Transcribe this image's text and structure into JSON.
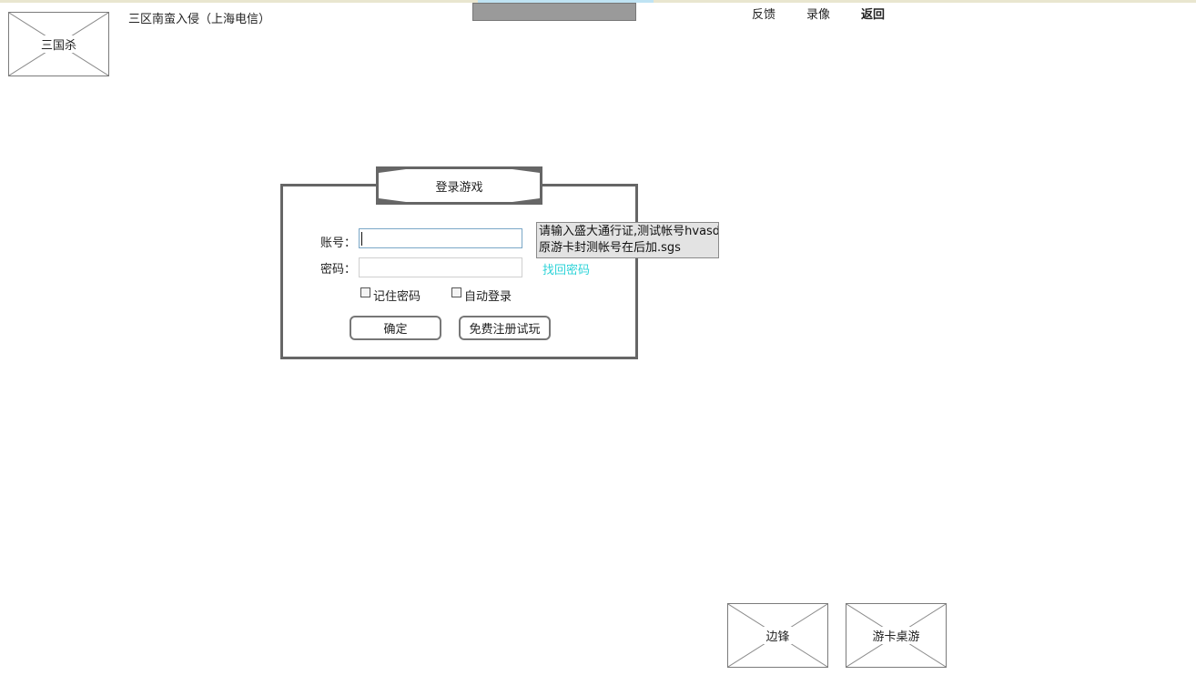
{
  "top": {
    "logo_label": "三国杀",
    "server_title": "三区南蛮入侵（上海电信）",
    "nav": {
      "feedback": "反馈",
      "recording": "录像",
      "back": "返回"
    }
  },
  "login": {
    "tab_title": "登录游戏",
    "account_label": "账号：",
    "password_label": "密码：",
    "account_value": "",
    "password_value": "",
    "forgot_password_link": "找回密码",
    "remember_password": {
      "label": "记住密码",
      "checked": false
    },
    "auto_login": {
      "label": "自动登录",
      "checked": false
    },
    "confirm_button": "确定",
    "register_button": "免费注册试玩"
  },
  "tooltip": {
    "line1": "请输入盛大通行证,测试帐号hvasd",
    "line2": "原游卡封测帐号在后加.sgs"
  },
  "bottom": {
    "tile1_label": "边锋",
    "tile2_label": "游卡桌游"
  }
}
